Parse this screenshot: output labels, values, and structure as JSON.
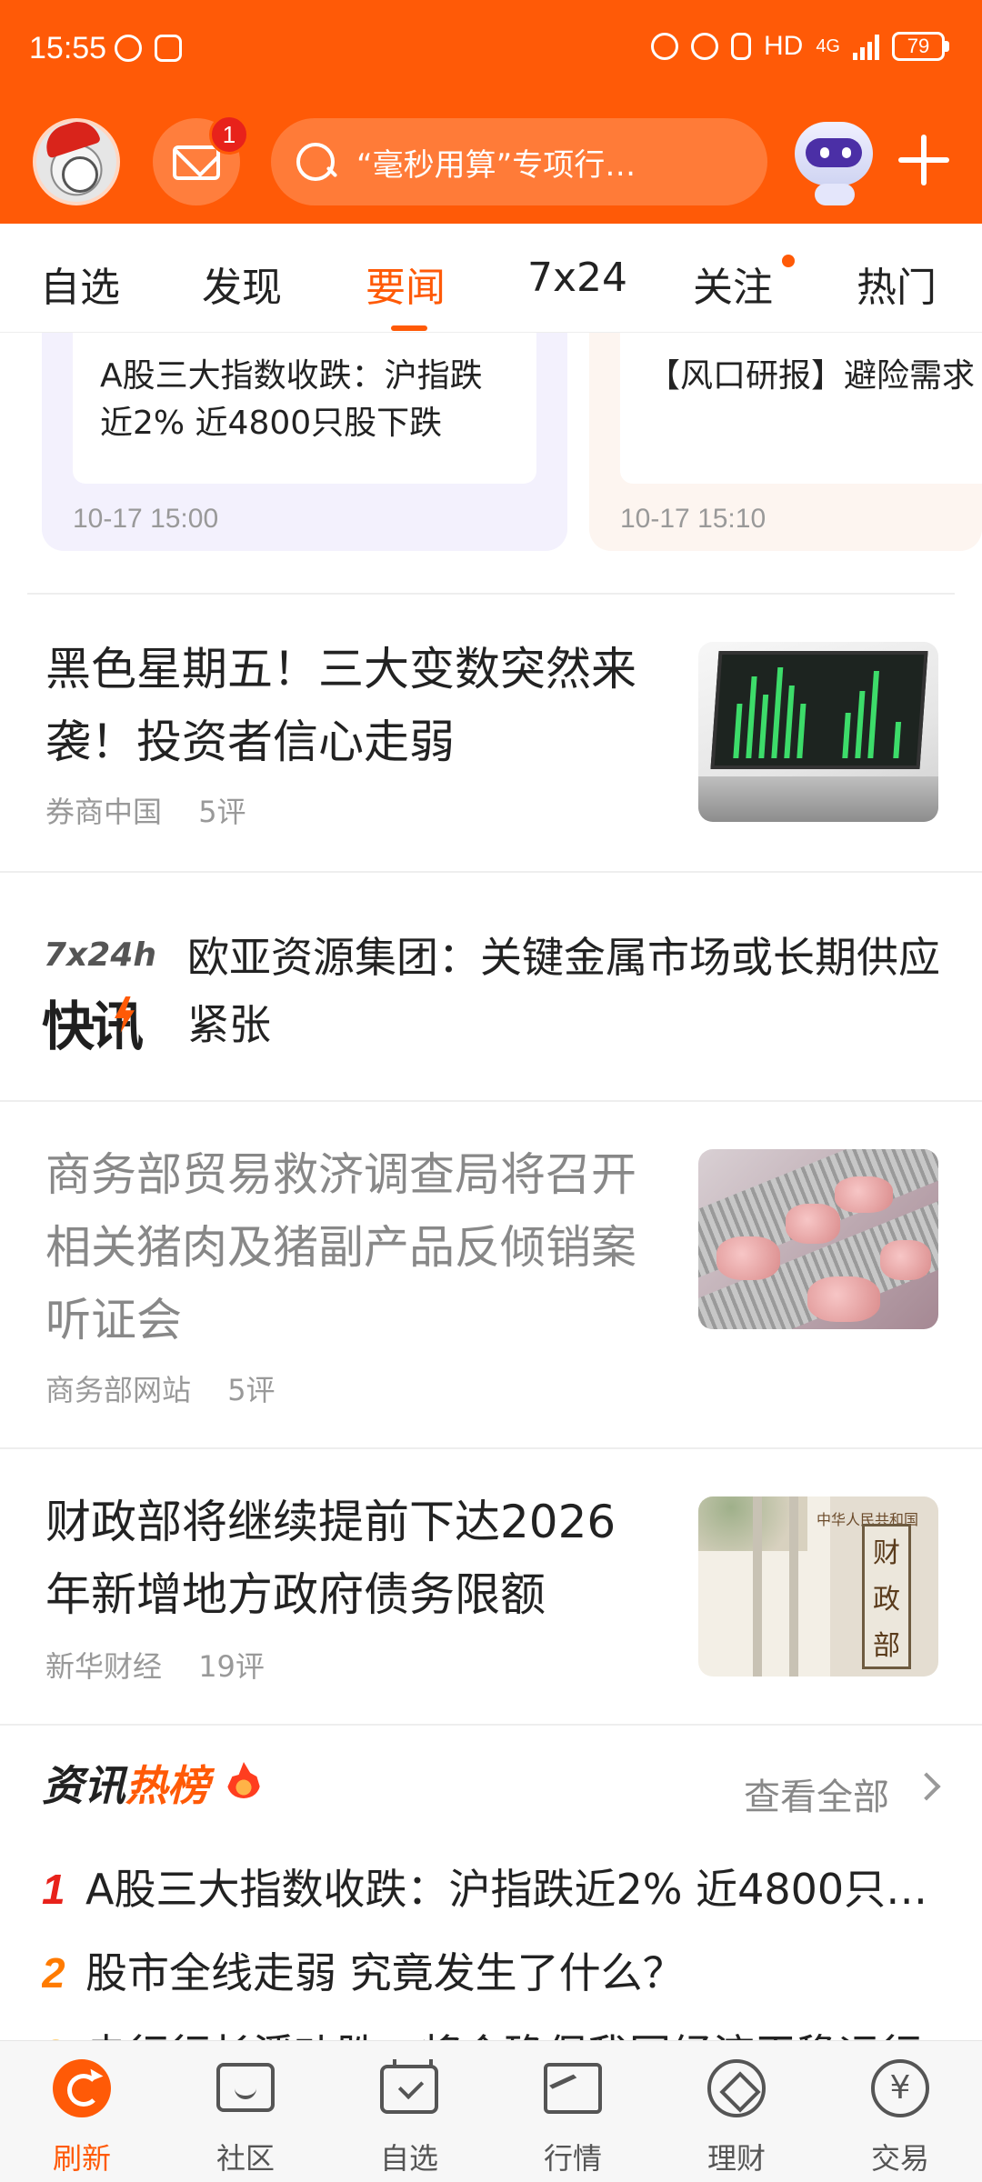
{
  "status_bar": {
    "time": "15:55",
    "network": "HD",
    "network_type": "4G",
    "battery": "79"
  },
  "header": {
    "mail_badge": "1",
    "search_placeholder": "“毫秒用算”专项行…"
  },
  "tabs": [
    {
      "label": "自选"
    },
    {
      "label": "发现"
    },
    {
      "label": "要闻",
      "active": true
    },
    {
      "label": "7x24"
    },
    {
      "label": "关注",
      "dot": true
    },
    {
      "label": "热门"
    }
  ],
  "cards": [
    {
      "text": "A股三大指数收跌：沪指跌近2% 近4800只股下跌",
      "time": "10-17 15:00"
    },
    {
      "text": "【风口研报】避险需求 激红利板块 煤炭行",
      "time": "10-17 15:10"
    }
  ],
  "news": [
    {
      "title": "黑色星期五！三大变数突然来袭！投资者信心走弱",
      "source": "券商中国",
      "comments": "5评"
    },
    {
      "title": "商务部贸易救济调查局将召开相关猪肉及猪副产品反倾销案听证会",
      "source": "商务部网站",
      "comments": "5评",
      "read": true
    },
    {
      "title": "财政部将继续提前下达2026年新增地方政府债务限额",
      "source": "新华财经",
      "comments": "19评"
    }
  ],
  "flash": {
    "logo_top": "7x24h",
    "logo_bottom": "快讯",
    "text": "欧亚资源集团：关键金属市场或长期供应紧张"
  },
  "thumb_labels": {
    "building_small": "中华人民共和国",
    "building_sign": [
      "财",
      "政",
      "部"
    ]
  },
  "hot_list": {
    "title_part1": "资讯",
    "title_part2": "热榜",
    "more": "查看全部",
    "items": [
      {
        "rank": "1",
        "text": "A股三大指数收跌：沪指跌近2% 近4800只…"
      },
      {
        "rank": "2",
        "text": "股市全线走弱 究竟发生了什么？"
      },
      {
        "rank": "3",
        "text": "央行行长潘功胜：将会确保我国经济平稳运行"
      }
    ]
  },
  "bottom_nav": [
    {
      "label": "刷新",
      "icon": "refresh-icon",
      "active": true
    },
    {
      "label": "社区",
      "icon": "community-icon"
    },
    {
      "label": "自选",
      "icon": "watchlist-icon"
    },
    {
      "label": "行情",
      "icon": "market-icon"
    },
    {
      "label": "理财",
      "icon": "finance-icon"
    },
    {
      "label": "交易",
      "icon": "trade-icon"
    }
  ],
  "colors": {
    "brand": "#ff5a07",
    "badge": "#e8221b"
  }
}
